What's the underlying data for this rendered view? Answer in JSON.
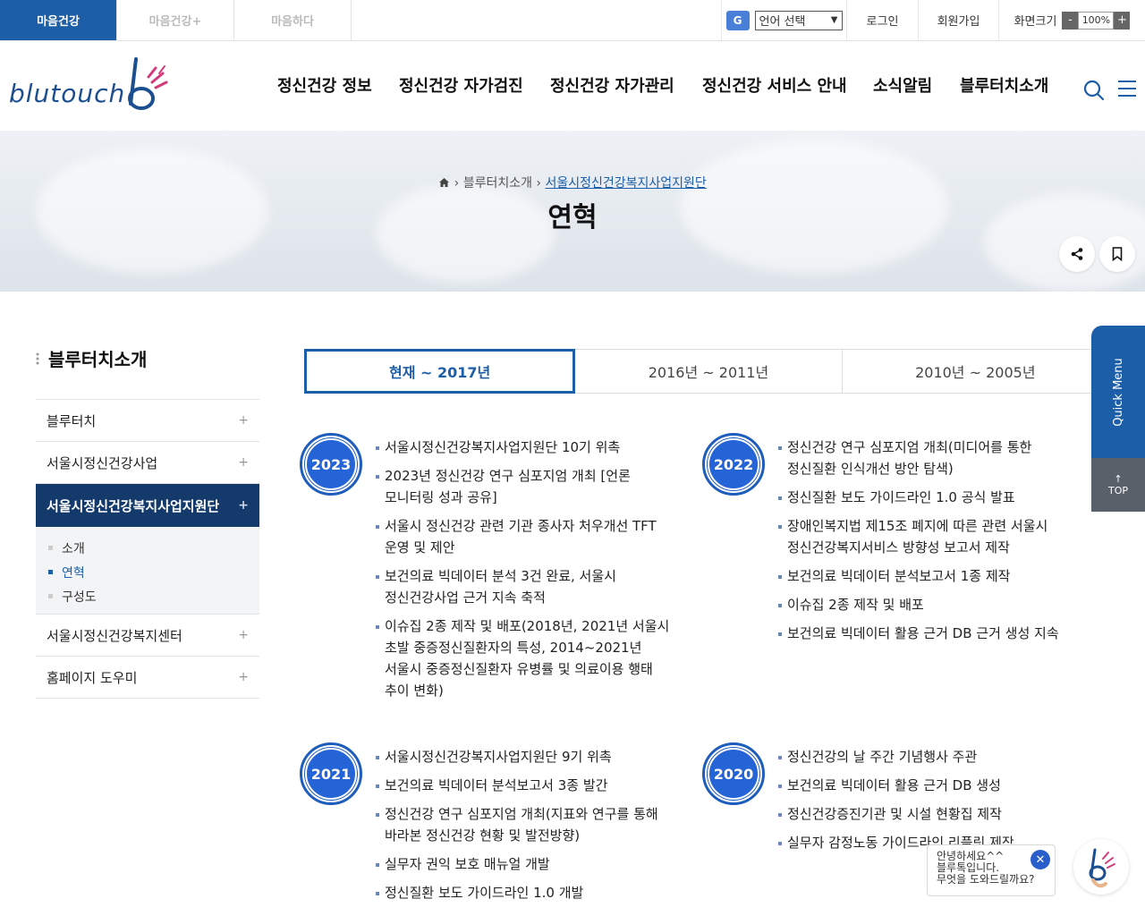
{
  "top_bar": {
    "site_tabs": [
      "마음건강",
      "마음건강+",
      "마음하다"
    ],
    "language_select": "언어 선택",
    "login": "로그인",
    "signup": "회원가입",
    "zoom_label": "화면크기",
    "zoom_minus": "-",
    "zoom_value": "100%",
    "zoom_plus": "+"
  },
  "header": {
    "logo_text": "blutouch",
    "nav": [
      "정신건강 정보",
      "정신건강 자가검진",
      "정신건강 자가관리",
      "정신건강 서비스 안내",
      "소식알림",
      "블루터치소개"
    ]
  },
  "banner": {
    "breadcrumb": [
      "블루터치소개",
      "서울시정신건강복지사업지원단"
    ],
    "title": "연혁"
  },
  "sidebar": {
    "title": "블루터치소개",
    "items": [
      {
        "label": "블루터치",
        "icon": "+"
      },
      {
        "label": "서울시정신건강사업",
        "icon": "+"
      },
      {
        "label": "서울시정신건강복지사업지원단",
        "icon": "+"
      },
      {
        "label": "서울시정신건강복지센터",
        "icon": "+"
      },
      {
        "label": "홈페이지 도우미",
        "icon": "+"
      }
    ],
    "sub_items": [
      "소개",
      "연혁",
      "구성도"
    ]
  },
  "tabs": [
    "현재 ~ 2017년",
    "2016년 ~ 2011년",
    "2010년 ~ 2005년"
  ],
  "history": [
    {
      "year": "2023",
      "items": [
        "서울시정신건강복지사업지원단 10기 위촉",
        "2023년 정신건강 연구 심포지엄 개최 [언론 모니터링 성과 공유]",
        "서울시 정신건강 관련 기관 종사자 처우개선 TFT 운영 및 제안",
        "보건의료 빅데이터 분석 3건 완료, 서울시 정신건강사업 근거 지속 축적",
        "이슈집 2종 제작 및 배포(2018년, 2021년 서울시 초발 중증정신질환자의 특성, 2014~2021년 서울시 중증정신질환자 유병률 및 의료이용 행태 추이 변화)"
      ]
    },
    {
      "year": "2022",
      "items": [
        "정신건강 연구 심포지엄 개최(미디어를 통한 정신질환 인식개선 방안 탐색)",
        "정신질환 보도 가이드라인 1.0 공식 발표",
        "장애인복지법 제15조 폐지에 따른 관련 서울시 정신건강복지서비스 방향성 보고서 제작",
        "보건의료 빅데이터 분석보고서 1종 제작",
        "이슈집 2종 제작 및 배포",
        "보건의료 빅데이터 활용 근거 DB 근거 생성 지속"
      ]
    },
    {
      "year": "2021",
      "items": [
        "서울시정신건강복지사업지원단 9기 위촉",
        "보건의료 빅데이터 분석보고서 3종 발간",
        "정신건강 연구 심포지엄 개최(지표와 연구를 통해 바라본 정신건강 현황 및 발전방향)",
        "실무자 권익 보호 매뉴얼 개발",
        "정신질환 보도 가이드라인 1.0 개발"
      ]
    },
    {
      "year": "2020",
      "items": [
        "정신건강의 날 주간 기념행사 주관",
        "보건의료 빅데이터 활용 근거 DB 생성",
        "정신건강증진기관 및 시설 현황집 제작",
        "실무자 감정노동 가이드라인 리플릿 제작"
      ]
    }
  ],
  "quick_menu": {
    "label": "Quick Menu",
    "top_label": "TOP"
  },
  "chatbot": {
    "message": [
      "안녕하세요^^",
      "블루톡입니다.",
      "무엇을 도와드릴까요?"
    ]
  },
  "colors": {
    "primary": "#1c5ea8",
    "sidebar_active": "#143a6b",
    "year_circle": "#2564d6"
  }
}
